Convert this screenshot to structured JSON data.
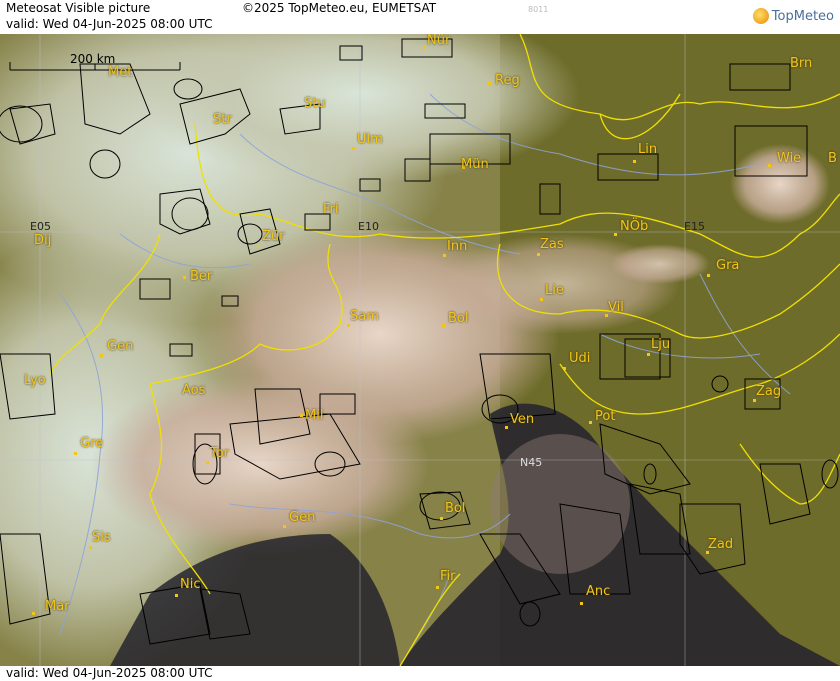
{
  "header": {
    "title": "Meteosat Visible picture",
    "valid": "valid:  Wed  04-Jun-2025  08:00 UTC",
    "copyright": "©2025 TopMeteo.eu, EUMETSAT",
    "code": "8011",
    "logo_text": "TopMeteo"
  },
  "footer": {
    "valid": "valid:  Wed  04-Jun-2025  08:00 UTC"
  },
  "map": {
    "scale_label": "200 km",
    "grid_labels": [
      "E05",
      "E10",
      "E15",
      "N45"
    ],
    "cities": [
      "Nür",
      "Met",
      "Reg",
      "Brn",
      "Stu",
      "Str",
      "Ulm",
      "Mün",
      "Lin",
      "Wie",
      "B",
      "Fri",
      "E10",
      "Inn",
      "Zas",
      "NÖb",
      "Zür",
      "Dij",
      "Ber",
      "Gra",
      "Lie",
      "Sam",
      "Bol",
      "Vil",
      "Gen",
      "Lju",
      "Udi",
      "Lyo",
      "Aos",
      "Mil",
      "Ven",
      "Pot",
      "Zag",
      "Gre",
      "Tor",
      "Gen",
      "Bol",
      "Zad",
      "Sis",
      "Fir",
      "Nic",
      "Mar",
      "Anc"
    ],
    "colors": {
      "city_label": "#f3c51b",
      "border": "#f0e000",
      "river": "#8fa3d8",
      "outline": "#000000"
    }
  }
}
